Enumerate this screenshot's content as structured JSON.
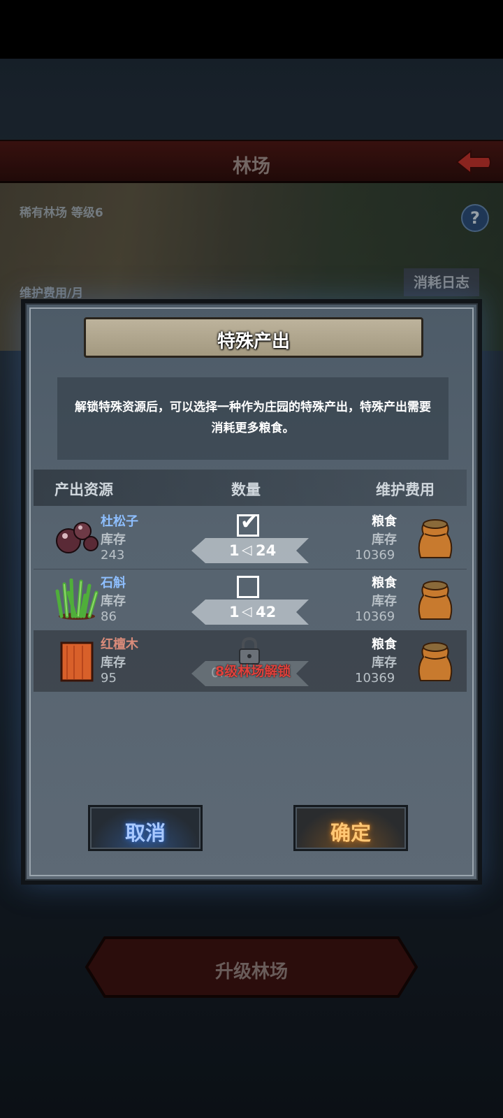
{
  "header": {
    "title": "林场"
  },
  "scene": {
    "subtitle": "稀有林场 等级6",
    "fee_label": "维护费用/月",
    "log_button": "消耗日志"
  },
  "dialog": {
    "title": "特殊产出",
    "description": "解锁特殊资源后，可以选择一种作为庄园的特殊产出，特殊产出需要消耗更多粮食。",
    "columns": {
      "resource": "产出资源",
      "quantity": "数量",
      "upkeep": "维护费用"
    },
    "rows": [
      {
        "name": "杜松子",
        "stock_label": "库存",
        "stock": "243",
        "checked": true,
        "ratio_left": "1",
        "ratio_right": "24",
        "cost_label": "粮食",
        "cost_stock_label": "库存",
        "cost_stock": "10369"
      },
      {
        "name": "石斛",
        "stock_label": "库存",
        "stock": "86",
        "checked": false,
        "ratio_left": "1",
        "ratio_right": "42",
        "cost_label": "粮食",
        "cost_stock_label": "库存",
        "cost_stock": "10369"
      },
      {
        "name": "红檀木",
        "stock_label": "库存",
        "stock": "95",
        "locked": true,
        "ratio_faint": "0.2",
        "unlock_note": "8级林场解锁",
        "cost_label": "粮食",
        "cost_stock_label": "库存",
        "cost_stock": "10369"
      }
    ],
    "cancel_label": "取消",
    "confirm_label": "确定"
  },
  "footer": {
    "upgrade_label": "升级林场"
  },
  "colors": {
    "cancel_glow": "#3a79e0",
    "confirm_glow": "#e08a2a",
    "resource_name": "#8ebfff",
    "locked_note": "#e0413c"
  }
}
